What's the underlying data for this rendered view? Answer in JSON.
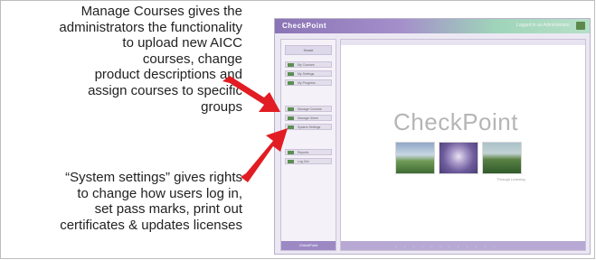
{
  "callouts": {
    "manage_courses": [
      "Manage Courses gives the",
      "administrators the functionality",
      "to upload new AICC",
      "courses, change",
      "product descriptions and",
      "assign courses to specific",
      "groups"
    ],
    "system_settings": [
      "“System settings” gives rights",
      "to change how users log in,",
      "set pass marks, print out",
      "certificates & updates licenses"
    ]
  },
  "app": {
    "logo_text": "CheckPoint",
    "title_link": "Logged in as Administrator",
    "brand_text": "CheckPoint",
    "tagline": "Through Learning",
    "sidebar": {
      "header": "Home",
      "items": [
        {
          "label": "My Courses"
        },
        {
          "label": "My Settings"
        },
        {
          "label": "My Progress"
        },
        {
          "label": "Manage Courses"
        },
        {
          "label": "Manage Users"
        },
        {
          "label": "System Settings"
        },
        {
          "label": "Reports"
        },
        {
          "label": "Log Out"
        }
      ],
      "footer": "CheckPoint"
    }
  },
  "colors": {
    "arrow": "#e21c23",
    "sidebar_icon": "#5b8f52",
    "title_bar_start": "#8b74b5",
    "title_bar_end": "#b6e0c8"
  }
}
